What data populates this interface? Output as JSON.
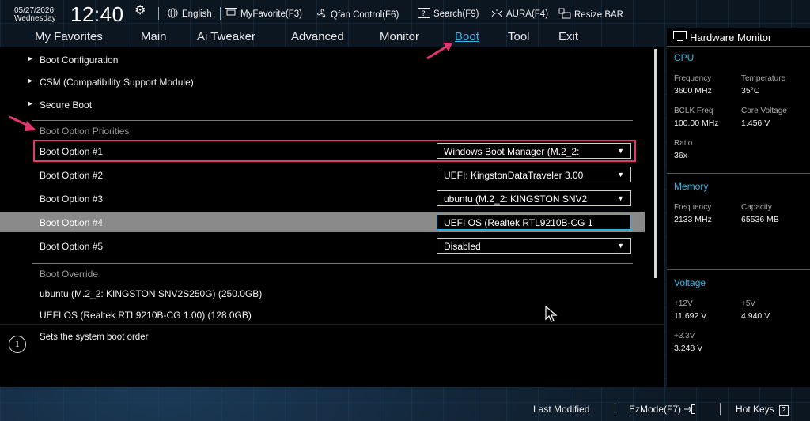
{
  "topbar": {
    "date": "05/27/2026",
    "weekday": "Wednesday",
    "time": "12:40",
    "items": [
      {
        "label": "English",
        "icon": "globe-icon"
      },
      {
        "label": "MyFavorite(F3)",
        "icon": "favorite-icon"
      },
      {
        "label": "Qfan Control(F6)",
        "icon": "fan-icon"
      },
      {
        "label": "Search(F9)",
        "icon": "search-icon"
      },
      {
        "label": "AURA(F4)",
        "icon": "aura-icon"
      },
      {
        "label": "Resize BAR",
        "icon": "resize-bar-icon"
      }
    ]
  },
  "menu": {
    "items": [
      "My Favorites",
      "Main",
      "Ai Tweaker",
      "Advanced",
      "Monitor",
      "Boot",
      "Tool",
      "Exit"
    ],
    "active": "Boot"
  },
  "main": {
    "submenus": [
      "Boot Configuration",
      "CSM (Compatibility Support Module)",
      "Secure Boot"
    ],
    "priorities_title": "Boot Option Priorities",
    "boot_options": [
      {
        "label": "Boot Option #1",
        "value": "Windows Boot Manager (M.2_2:"
      },
      {
        "label": "Boot Option #2",
        "value": "UEFI: KingstonDataTraveler 3.00"
      },
      {
        "label": "Boot Option #3",
        "value": "ubuntu (M.2_2: KINGSTON SNV2"
      },
      {
        "label": "Boot Option #4",
        "value": "UEFI OS (Realtek RTL9210B-CG 1"
      },
      {
        "label": "Boot Option #5",
        "value": "Disabled"
      }
    ],
    "override_title": "Boot Override",
    "override_items": [
      "ubuntu (M.2_2: KINGSTON SNV2S250G) (250.0GB)",
      "UEFI OS (Realtek RTL9210B-CG 1.00) (128.0GB)"
    ]
  },
  "help": {
    "text": "Sets the system boot order"
  },
  "hardware_monitor": {
    "title": "Hardware Monitor",
    "cpu": {
      "title": "CPU",
      "frequency_label": "Frequency",
      "frequency": "3600 MHz",
      "temperature_label": "Temperature",
      "temperature": "35°C",
      "bclk_label": "BCLK Freq",
      "bclk": "100.00 MHz",
      "core_voltage_label": "Core Voltage",
      "core_voltage": "1.456 V",
      "ratio_label": "Ratio",
      "ratio": "36x"
    },
    "memory": {
      "title": "Memory",
      "frequency_label": "Frequency",
      "frequency": "2133 MHz",
      "capacity_label": "Capacity",
      "capacity": "65536 MB"
    },
    "voltage": {
      "title": "Voltage",
      "v12_label": "+12V",
      "v12": "11.692 V",
      "v5_label": "+5V",
      "v5": "4.940 V",
      "v33_label": "+3.3V",
      "v33": "3.248 V"
    }
  },
  "bottombar": {
    "last_modified": "Last Modified",
    "ezmode": "EzMode(F7)",
    "hotkeys": "Hot Keys",
    "hotkeys_icon": "?"
  },
  "colors": {
    "accent": "#2fb6e8",
    "highlight_outline": "#e0386e",
    "annotation_arrow": "#e0386e",
    "selected_row": "#8a8a8a"
  }
}
